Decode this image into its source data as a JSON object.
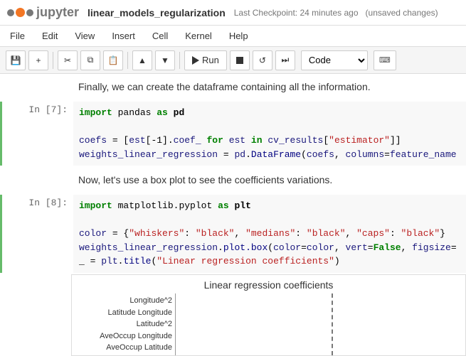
{
  "topbar": {
    "title": "linear_models_regularization",
    "checkpoint": "Last Checkpoint: 24 minutes ago",
    "unsaved": "(unsaved changes)"
  },
  "menu": {
    "items": [
      "File",
      "Edit",
      "View",
      "Insert",
      "Cell",
      "Kernel",
      "Help"
    ]
  },
  "toolbar": {
    "run_label": "Run",
    "kernel_option": "Code"
  },
  "cells": {
    "text1": "Finally, we can create the dataframe containing all the information.",
    "cell7_label": "In [7]:",
    "cell7_lines": [
      "import pandas as pd",
      "",
      "coefs = [est[-1].coef_  for est in cv_results[\"estimator\"]]",
      "weights_linear_regression = pd.DataFrame(coefs, columns=feature_name"
    ],
    "text2": "Now, let's use a box plot to see the coefficients variations.",
    "cell8_label": "In [8]:",
    "cell8_lines": [
      "import matplotlib.pyplot as plt",
      "",
      "color = {\"whiskers\": \"black\", \"medians\": \"black\", \"caps\": \"black\"}",
      "weights_linear_regression.plot.box(color=color, vert=False, figsize=",
      "_ = plt.title(\"Linear regression coefficients\")"
    ],
    "plot_title": "Linear regression coefficients",
    "plot_labels": [
      "Longitude^2",
      "Latitude Longitude",
      "Latitude^2",
      "AveOccup Longitude",
      "AveOccup Latitude"
    ],
    "plot_dashed_positions": [
      "60%"
    ]
  }
}
